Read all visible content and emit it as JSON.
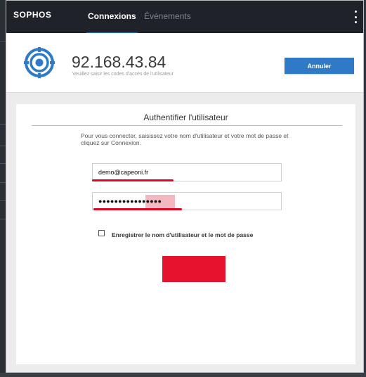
{
  "app": {
    "brand": "SOPHOS",
    "tabs": [
      {
        "label": "Connexions",
        "active": true
      },
      {
        "label": "Événements",
        "active": false
      }
    ],
    "menu_icon": "kebab-menu-icon"
  },
  "header": {
    "icon": "target-icon",
    "host_ip": "92.168.43.84",
    "subtitle": "Veuillez saisir les codes d'accès de l'utilisateur",
    "cancel_label": "Annuler"
  },
  "auth": {
    "title": "Authentifier l'utilisateur",
    "instructions": "Pour vous connecter, saisissez votre nom d'utilisateur et votre mot de passe et cliquez sur Connexion.",
    "username_value": "demo@capeoni.fr",
    "password_mask": "●●●●●●●●●●●●●●●●",
    "remember_label": "Enregistrer le nom d'utilisateur et le mot de passe",
    "remember_checked": false
  },
  "colors": {
    "accent": "#2e7ac7",
    "topbar": "#1f2329",
    "annotation_red": "#e0061f",
    "login_button": "#e5132b"
  }
}
